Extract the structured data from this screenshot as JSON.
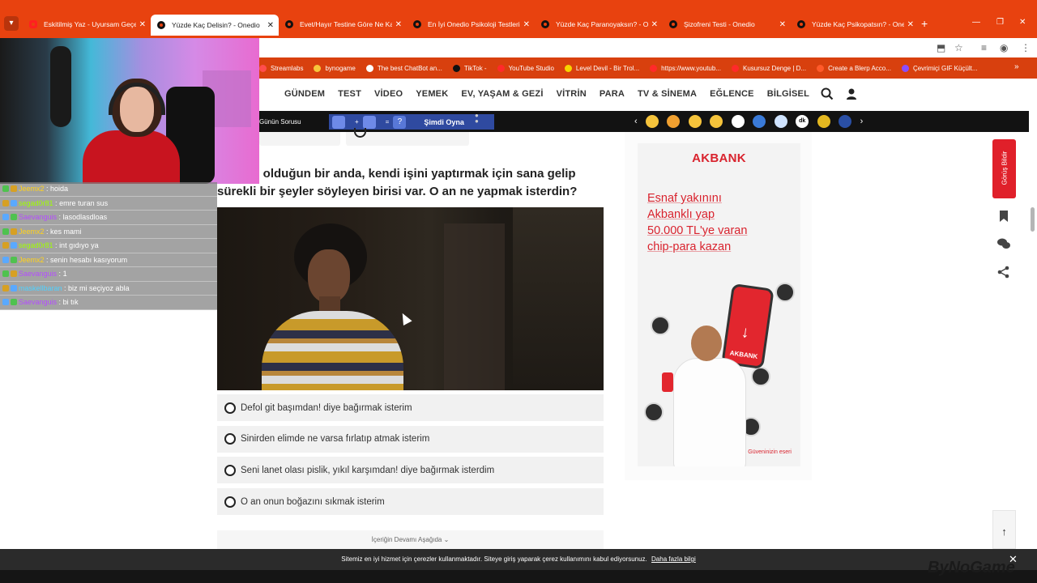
{
  "browser": {
    "tabs": [
      {
        "title": "Eskitilmiş Yaz - Uyursam Geçer",
        "icon": "youtube-icon",
        "active": false
      },
      {
        "title": "Yüzde Kaç Delisin? - Onedio",
        "icon": "onedio-icon",
        "active": true
      },
      {
        "title": "Evet/Hayır Testine Göre Ne Kad",
        "icon": "onedio-icon",
        "active": false
      },
      {
        "title": "En İyi Onedio Psikoloji Testleri",
        "icon": "onedio-icon",
        "active": false
      },
      {
        "title": "Yüzde Kaç Paranoyaksın? - One",
        "icon": "onedio-icon",
        "active": false
      },
      {
        "title": "Şizofreni Testi - Onedio",
        "icon": "onedio-icon",
        "active": false
      },
      {
        "title": "Yüzde Kaç Psikopatsın? - Onedi",
        "icon": "onedio-icon",
        "active": false
      }
    ],
    "new_tab": "+",
    "bookmarks": [
      "Streamlabs",
      "bynogame",
      "The best ChatBot an...",
      "TikTok -",
      "YouTube Studio",
      "Level Devil - Bir Trol...",
      "https://www.youtub...",
      "Kusursuz Denge | D...",
      "Create a Blerp Acco...",
      "Çevrimiçi GIF Küçült..."
    ]
  },
  "site_nav": {
    "items": [
      "GÜNDEM",
      "TEST",
      "VİDEO",
      "YEMEK",
      "EV, YAŞAM & GEZİ",
      "VİTRİN",
      "PARA",
      "TV & SİNEMA",
      "EĞLENCE",
      "BİLGİSEL"
    ]
  },
  "strip": {
    "gunun_sorusu": "Günün Sorusu",
    "chip_plus": "+",
    "chip_eq": "=",
    "chip_q": "?",
    "play": "Şimdi Oyna",
    "dk_label": "dk",
    "prev": "‹",
    "next": "›"
  },
  "question": {
    "text": "meşgul olduğun bir anda, kendi işini yaptırmak için sana gelip sürekli bir şeyler söyleyen birisi var. O an ne yapmak isterdin?",
    "answers": [
      "Defol git başımdan! diye bağırmak isterim",
      "Sinirden elimde ne varsa fırlatıp atmak isterim",
      "Seni lanet olası pislik, yıkıl karşımdan! diye bağırmak isterdim",
      "O an onun boğazını sıkmak isterim"
    ],
    "more": "İçeriğin Devamı Aşağıda"
  },
  "ad": {
    "brand": "AKBANK",
    "lines": [
      "Esnaf yakınını",
      "Akbanklı yap",
      "50.000 TL'ye varan",
      "chip-para kazan"
    ],
    "phone_label": "AKBANK",
    "footer": "Güveninizin eseri"
  },
  "rail": {
    "feedback": "Görüş Bildir"
  },
  "cookie": {
    "text": "Sitemiz en iyi hizmet için çerezler kullanmaktadır. Siteye giriş yaparak çerez kullanımını kabul ediyorsunuz.",
    "link": "Daha fazla bilgi",
    "close": "✕"
  },
  "chat": [
    {
      "user": "Jeemx2",
      "msg": "hoida",
      "color": "u-yellow"
    },
    {
      "user": "segad0r81",
      "msg": "emre turan sus",
      "color": "u-green"
    },
    {
      "user": "Saevanguis",
      "msg": "lasodlasdloas",
      "color": "u-purple"
    },
    {
      "user": "Jeemx2",
      "msg": "kes mami",
      "color": "u-yellow"
    },
    {
      "user": "segad0r81",
      "msg": "int gıdıyo ya",
      "color": "u-green"
    },
    {
      "user": "Jeemx2",
      "msg": "senin hesabı kasıyorum",
      "color": "u-yellow"
    },
    {
      "user": "Saevanguis",
      "msg": "1",
      "color": "u-purple"
    },
    {
      "user": "maskellbaran",
      "msg": "biz mi seçiyoz abla",
      "color": "u-blue"
    },
    {
      "user": "Saevanguis",
      "msg": "bi tık",
      "color": "u-purple"
    }
  ],
  "watermark": "ByNoGame"
}
